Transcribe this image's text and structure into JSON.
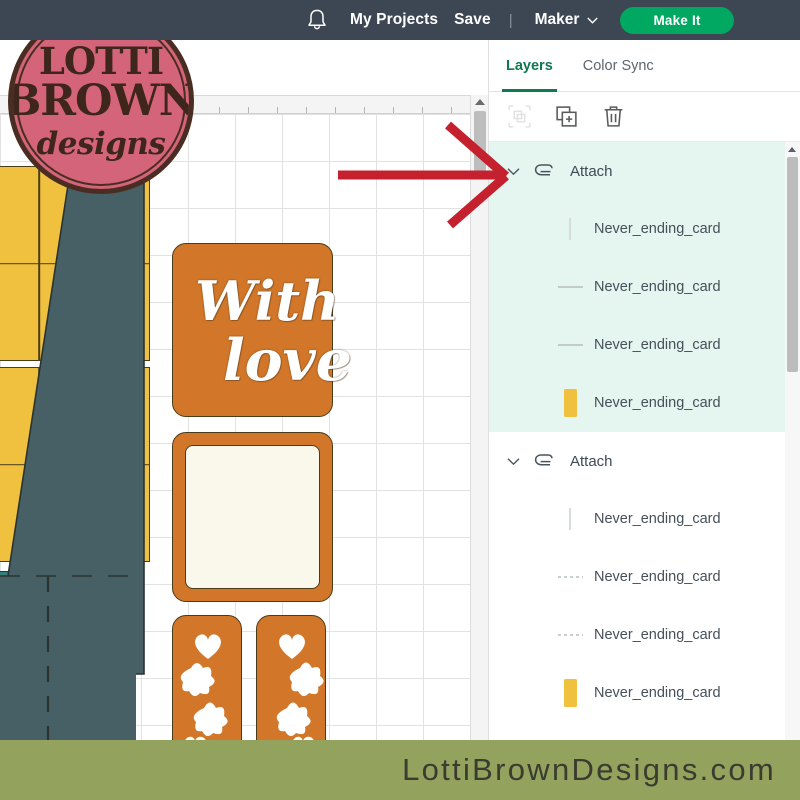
{
  "topbar": {
    "bell_icon": "bell-icon",
    "my_projects": "My Projects",
    "save": "Save",
    "separator": "|",
    "machine": "Maker",
    "machine_caret_icon": "chevron-down-icon",
    "make_it": "Make It",
    "bg_color": "#3d4753",
    "make_it_color": "#00a862"
  },
  "canvas": {
    "grid_color": "#e2e2e2",
    "shapes": {
      "yellow": "#efc13e",
      "orange": "#d2772a",
      "cream": "#faf8ea",
      "teal": "#36807c",
      "slate": "#466066",
      "outline": "#4a3b1a"
    },
    "card_text_line1": "With",
    "card_text_line2": "love"
  },
  "panel": {
    "tabs": [
      {
        "label": "Layers",
        "active": true
      },
      {
        "label": "Color Sync",
        "active": false
      }
    ],
    "active_tab_color": "#0e7a4f",
    "toolbar": [
      {
        "icon": "group-icon",
        "disabled": true
      },
      {
        "icon": "duplicate-icon",
        "disabled": false
      },
      {
        "icon": "delete-icon",
        "disabled": false
      }
    ],
    "groups": [
      {
        "label": "Attach",
        "icon": "attach-paperclip-icon",
        "caret_icon": "chevron-down-icon",
        "selected": true,
        "highlight_color": "#e4f6ef",
        "children": [
          {
            "label": "Never_ending_card",
            "swatch": "cut-line"
          },
          {
            "label": "Never_ending_card",
            "swatch": "score-line"
          },
          {
            "label": "Never_ending_card",
            "swatch": "score-line"
          },
          {
            "label": "Never_ending_card",
            "swatch": "fill",
            "color": "#efc13e"
          }
        ]
      },
      {
        "label": "Attach",
        "icon": "attach-paperclip-icon",
        "caret_icon": "chevron-down-icon",
        "selected": false,
        "children": [
          {
            "label": "Never_ending_card",
            "swatch": "cut-line"
          },
          {
            "label": "Never_ending_card",
            "swatch": "perforate-line"
          },
          {
            "label": "Never_ending_card",
            "swatch": "perforate-line"
          },
          {
            "label": "Never_ending_card",
            "swatch": "fill",
            "color": "#efc13e"
          }
        ]
      }
    ]
  },
  "logo": {
    "line1": "LOTTI",
    "line2": "BROWN",
    "line3": "designs",
    "bg_color": "#d4647a",
    "ink_color": "#3f261c"
  },
  "annotation": {
    "arrow_color": "#c4202e",
    "arrow_name": "red-pointer-arrow"
  },
  "banner": {
    "text": "LottiBrownDesigns.com",
    "bg_color": "#93a35d",
    "text_color": "#3b3b30"
  }
}
